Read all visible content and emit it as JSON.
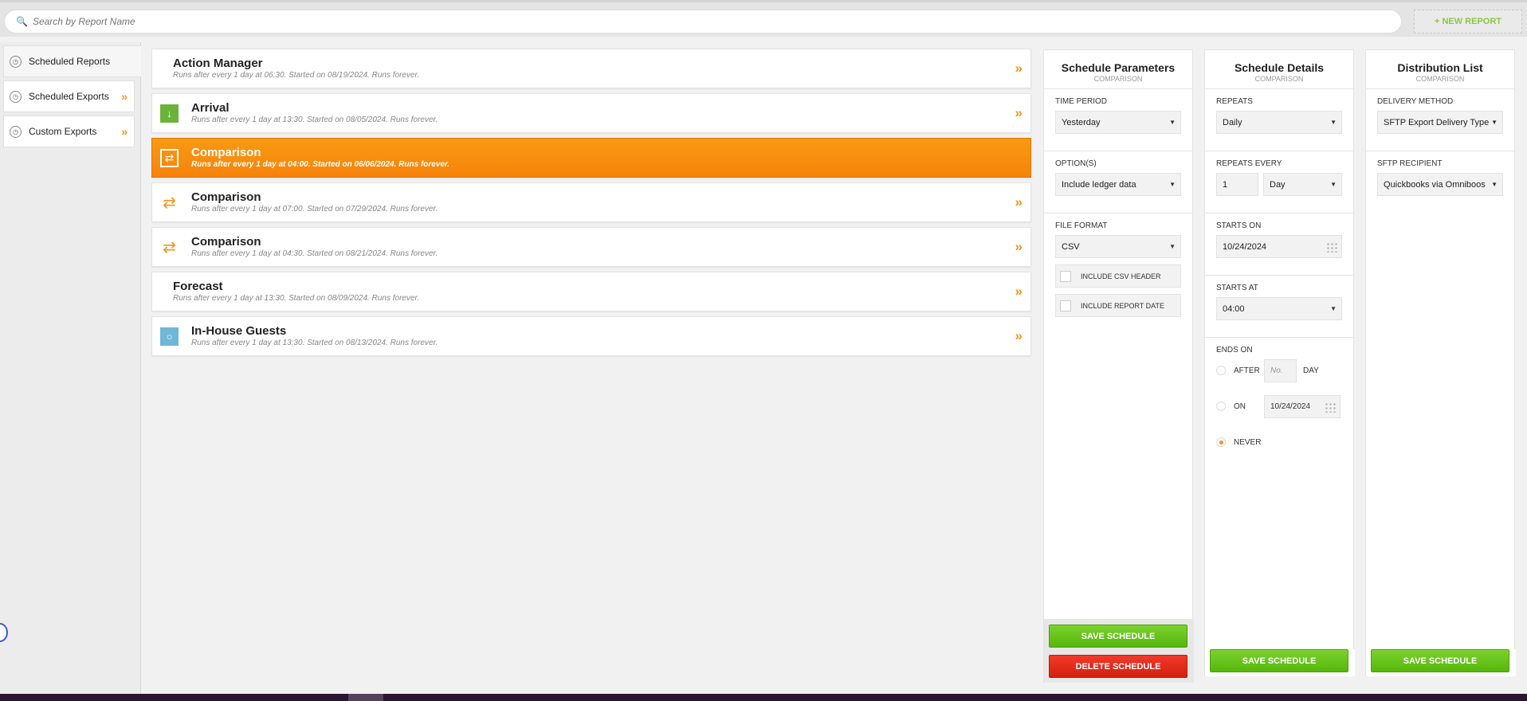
{
  "search": {
    "placeholder": "Search by Report Name"
  },
  "new_report_label": "+ NEW REPORT",
  "sidebar": {
    "items": [
      {
        "label": "Scheduled Reports"
      },
      {
        "label": "Scheduled Exports"
      },
      {
        "label": "Custom Exports"
      }
    ]
  },
  "reports": [
    {
      "title": "Action Manager",
      "subtitle": "Runs after every 1 day at 06:30. Started on 08/19/2024. Runs forever."
    },
    {
      "title": "Arrival",
      "subtitle": "Runs after every 1 day at 13:30. Started on 08/05/2024. Runs forever."
    },
    {
      "title": "Comparison",
      "subtitle": "Runs after every 1 day at 04:00. Started on 06/06/2024. Runs forever."
    },
    {
      "title": "Comparison",
      "subtitle": "Runs after every 1 day at 07:00. Started on 07/29/2024. Runs forever."
    },
    {
      "title": "Comparison",
      "subtitle": "Runs after every 1 day at 04:30. Started on 08/21/2024. Runs forever."
    },
    {
      "title": "Forecast",
      "subtitle": "Runs after every 1 day at 13:30. Started on 08/09/2024. Runs forever."
    },
    {
      "title": "In-House Guests",
      "subtitle": "Runs after every 1 day at 13:30. Started on 08/13/2024. Runs forever."
    }
  ],
  "params": {
    "title": "Schedule Parameters",
    "subtitle": "COMPARISON",
    "time_period_label": "TIME PERIOD",
    "time_period": "Yesterday",
    "options_label": "OPTION(S)",
    "options": "Include ledger data",
    "file_format_label": "FILE FORMAT",
    "file_format": "CSV",
    "csv_header_label": "INCLUDE CSV HEADER",
    "report_date_label": "INCLUDE REPORT DATE",
    "save_label": "SAVE SCHEDULE",
    "delete_label": "DELETE SCHEDULE"
  },
  "details": {
    "title": "Schedule Details",
    "subtitle": "COMPARISON",
    "repeats_label": "REPEATS",
    "repeats": "Daily",
    "repeats_every_label": "REPEATS EVERY",
    "repeats_every_value": "1",
    "repeats_every_unit": "Day",
    "starts_on_label": "STARTS ON",
    "starts_on": "10/24/2024",
    "starts_at_label": "STARTS AT",
    "starts_at": "04:00",
    "ends_on_label": "ENDS ON",
    "after_label": "AFTER",
    "after_placeholder": "No.",
    "day_label": "DAY",
    "on_label": "ON",
    "on_date": "10/24/2024",
    "never_label": "NEVER",
    "save_label": "SAVE SCHEDULE"
  },
  "distribution": {
    "title": "Distribution List",
    "subtitle": "COMPARISON",
    "delivery_method_label": "DELIVERY METHOD",
    "delivery_method": "SFTP Export Delivery Type",
    "sftp_recipient_label": "SFTP RECIPIENT",
    "sftp_recipient": "Quickbooks via Omniboos",
    "save_label": "SAVE SCHEDULE"
  },
  "colors": {
    "accent": "#f7941d",
    "green": "#5fbd14",
    "red": "#e22b1a"
  }
}
